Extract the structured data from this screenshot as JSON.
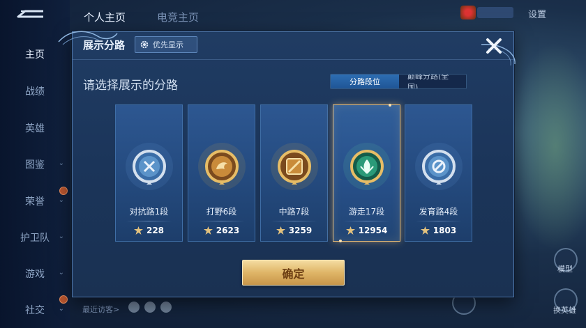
{
  "background": {
    "nav_items": [
      {
        "label": "主页",
        "active": true,
        "chevron": false,
        "badge": false
      },
      {
        "label": "战绩",
        "active": false,
        "chevron": false,
        "badge": false
      },
      {
        "label": "英雄",
        "active": false,
        "chevron": false,
        "badge": false
      },
      {
        "label": "图鉴",
        "active": false,
        "chevron": true,
        "badge": false
      },
      {
        "label": "荣誉",
        "active": false,
        "chevron": true,
        "badge": true
      },
      {
        "label": "护卫队",
        "active": false,
        "chevron": true,
        "badge": false
      },
      {
        "label": "游戏",
        "active": false,
        "chevron": true,
        "badge": false
      },
      {
        "label": "社交",
        "active": false,
        "chevron": true,
        "badge": true
      }
    ],
    "top_tabs": [
      {
        "label": "个人主页",
        "active": true
      },
      {
        "label": "电竞主页",
        "active": false
      }
    ],
    "settings_label": "设置",
    "recent_visitors_label": "最近访客>",
    "model_label": "模型",
    "change_hero_label": "换英雄"
  },
  "modal": {
    "title": "展示分路",
    "priority_label": "优先显示",
    "subtitle": "请选择展示的分路",
    "tabs": [
      {
        "label": "分路段位",
        "active": true
      },
      {
        "label": "巅峰分路(全国)",
        "active": false
      }
    ],
    "cards": [
      {
        "label": "对抗路1段",
        "score": "228",
        "emblem": "shield-sword-emblem-icon",
        "accent": "#c9d6e6",
        "selected": false
      },
      {
        "label": "打野6段",
        "score": "2623",
        "emblem": "dragon-emblem-icon",
        "accent": "#e0b25a",
        "selected": false
      },
      {
        "label": "中路7段",
        "score": "3259",
        "emblem": "staff-emblem-icon",
        "accent": "#e0b25a",
        "selected": false
      },
      {
        "label": "游走17段",
        "score": "12954",
        "emblem": "leaf-emblem-icon",
        "accent": "#49b38d",
        "selected": true
      },
      {
        "label": "发育路4段",
        "score": "1803",
        "emblem": "arrow-ring-emblem-icon",
        "accent": "#c9d6e6",
        "selected": false
      }
    ],
    "confirm_label": "确定"
  },
  "colors": {
    "accent_gold": "#e8bd78",
    "active_tab": "#2d6eb3",
    "panel": "#1f3b61"
  }
}
